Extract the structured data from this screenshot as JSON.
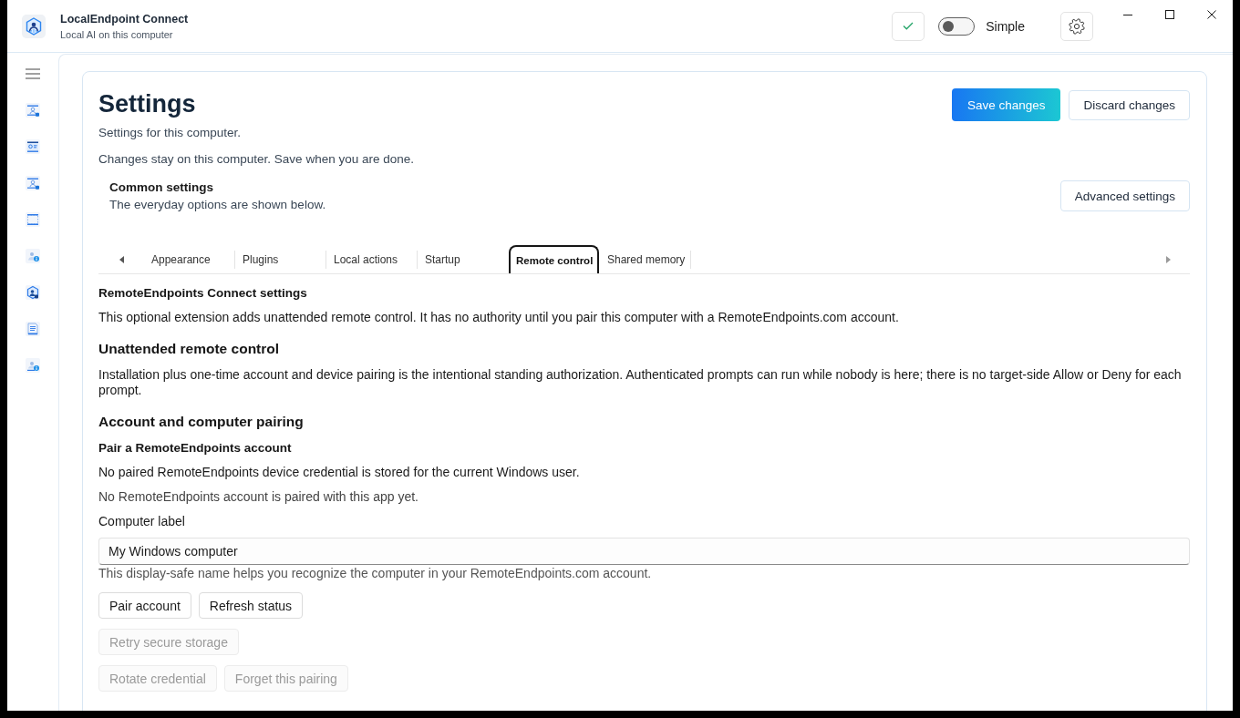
{
  "window": {
    "title": "LocalEndpoint Connect",
    "subtitle": "Local AI on this computer"
  },
  "title_bar": {
    "mode_toggle": {
      "label": "Simple",
      "on": false
    }
  },
  "page": {
    "title": "Settings",
    "subtitle": "Settings for this computer.",
    "note": "Changes stay on this computer. Save when you are done.",
    "actions": [
      {
        "label": "Save changes",
        "kind": "primary"
      },
      {
        "label": "Discard changes",
        "kind": "secondary"
      }
    ]
  },
  "common": {
    "title": "Common settings",
    "description": "The everyday options are shown below.",
    "button": "Advanced settings"
  },
  "tabs": [
    {
      "label": "Appearance",
      "selected": false
    },
    {
      "label": "Plugins",
      "selected": false
    },
    {
      "label": "Local actions",
      "selected": false
    },
    {
      "label": "Startup",
      "selected": false
    },
    {
      "label": "Remote control",
      "selected": true
    },
    {
      "label": "Shared memory",
      "selected": false
    }
  ],
  "content": [
    {
      "kind": "subheading",
      "text": "RemoteEndpoints Connect settings"
    },
    {
      "kind": "text",
      "text": "This optional extension adds unattended remote control. It has no authority until you pair this computer with a RemoteEndpoints.com account."
    },
    {
      "kind": "heading",
      "text": "Unattended remote control"
    },
    {
      "kind": "text",
      "text": "Installation plus one-time account and device pairing is the intentional standing authorization. Authenticated prompts can run while nobody is here; there is no target-side Allow or Deny for each prompt."
    },
    {
      "kind": "heading",
      "text": "Account and computer pairing"
    },
    {
      "kind": "subheading",
      "text": "Pair a RemoteEndpoints account"
    },
    {
      "kind": "text",
      "text": "No paired RemoteEndpoints device credential is stored for the current Windows user."
    },
    {
      "kind": "status",
      "text": "No RemoteEndpoints account is paired with this app yet."
    },
    {
      "kind": "field",
      "label": "Computer label",
      "value": "My Windows computer",
      "hint": "This display-safe name helps you recognize the computer in your RemoteEndpoints.com account."
    },
    {
      "kind": "buttons",
      "buttons": [
        {
          "label": "Pair account",
          "disabled": false
        },
        {
          "label": "Refresh status",
          "disabled": false
        }
      ]
    },
    {
      "kind": "buttons",
      "buttons": [
        {
          "label": "Retry secure storage",
          "disabled": true
        }
      ]
    },
    {
      "kind": "buttons",
      "buttons": [
        {
          "label": "Rotate credential",
          "disabled": true
        },
        {
          "label": "Forget this pairing",
          "disabled": true
        }
      ]
    }
  ]
}
